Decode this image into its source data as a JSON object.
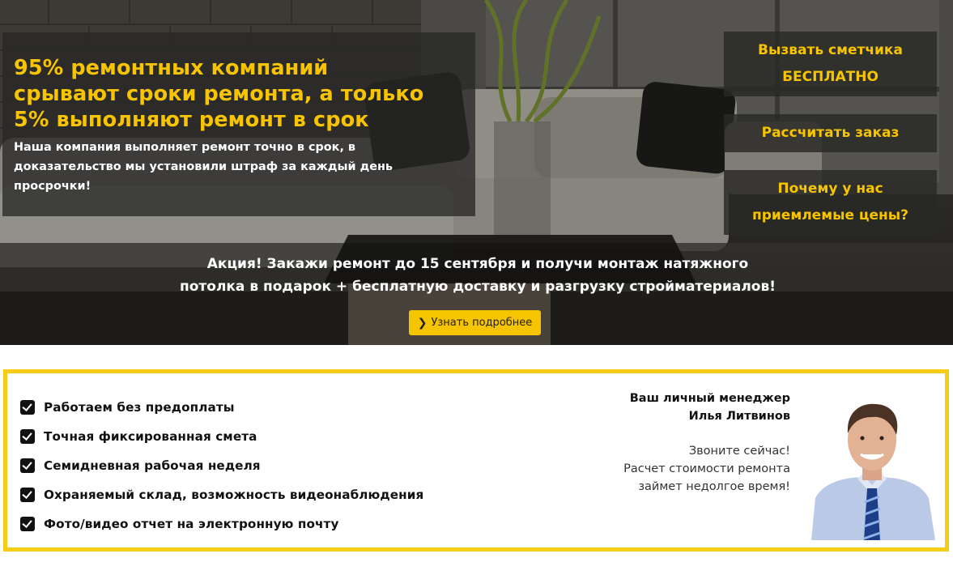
{
  "hero": {
    "headline": [
      "95% ремонтных компаний",
      "срывают сроки ремонта, а только",
      "5% выполняют ремонт в срок"
    ],
    "subline": "Наша компания выполняет ремонт точно в срок, в доказательство мы установили штраф за каждый день просрочки!",
    "side_buttons": [
      {
        "lines": [
          "Вызвать сметчика",
          "БЕСПЛАТНО"
        ]
      },
      {
        "lines": [
          "Рассчитать заказ"
        ]
      },
      {
        "lines": [
          "Почему у нас",
          "приемлемые цены?"
        ]
      }
    ],
    "promo": [
      "Акция! Закажи ремонт до 15 сентября и получи монтаж натяжного",
      "потолка в подарок + бесплатную доставку и разгрузку стройматериалов!"
    ],
    "more_button": {
      "icon": "chevron-right-icon",
      "label": "Узнать подробнее"
    }
  },
  "benefits": [
    "Работаем без предоплаты",
    "Точная фиксированная смета",
    "Семидневная рабочая неделя",
    "Охраняемый склад, возможность видеонаблюдения",
    "Фото/видео отчет на электронную почту"
  ],
  "manager": {
    "title_lines": [
      "Ваш личный менеджер",
      "Илья Литвинов"
    ],
    "call_lines": [
      "Звоните сейчас!",
      "Расчет стоимости ремонта",
      "займет недолгое время!"
    ]
  },
  "colors": {
    "accent": "#f6c400",
    "panel_border": "#f6cc17",
    "overlay": "#282826"
  }
}
